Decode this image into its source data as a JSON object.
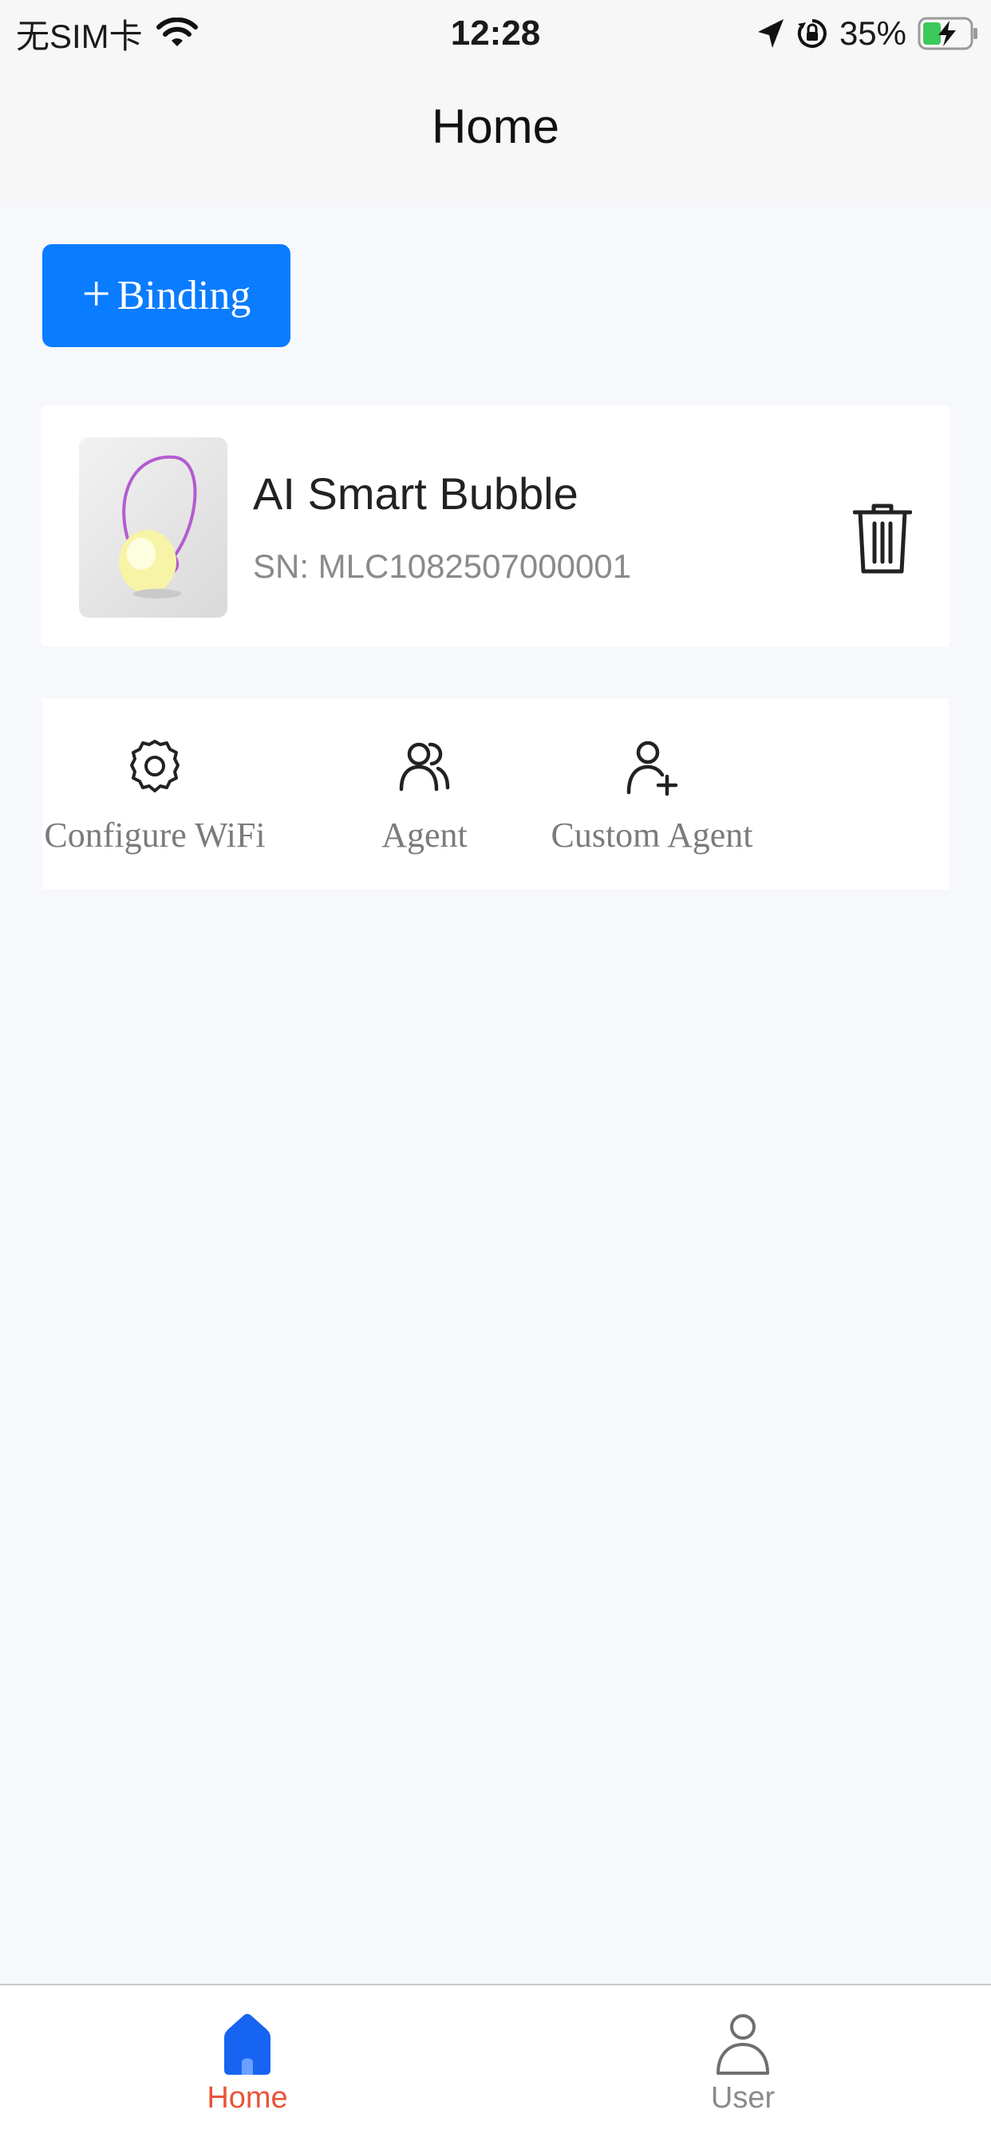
{
  "status_bar": {
    "carrier": "无SIM卡",
    "time": "12:28",
    "battery": "35%",
    "icons": [
      "wifi-icon",
      "location-icon",
      "orientation-lock-icon",
      "battery-charging-icon"
    ]
  },
  "nav": {
    "title": "Home"
  },
  "binding_button": {
    "plus": "+",
    "label": "Binding"
  },
  "device": {
    "name": "AI Smart Bubble",
    "sn": "SN: MLC1082507000001",
    "delete_icon": "trash-icon"
  },
  "actions": [
    {
      "label": "Configure WiFi",
      "icon": "gear-icon"
    },
    {
      "label": "Agent",
      "icon": "users-icon"
    },
    {
      "label": "Custom Agent",
      "icon": "user-add-icon"
    }
  ],
  "tab_bar": {
    "tabs": [
      {
        "label": "Home",
        "icon": "home-icon",
        "active": true
      },
      {
        "label": "User",
        "icon": "user-icon",
        "active": false
      }
    ]
  },
  "colors": {
    "primary": "#0a7cff",
    "active_tab_icon": "#1764f2",
    "active_tab_label": "#e8553a",
    "inactive_tab": "#8a8a8a",
    "page_bg": "#f6f8fc"
  }
}
